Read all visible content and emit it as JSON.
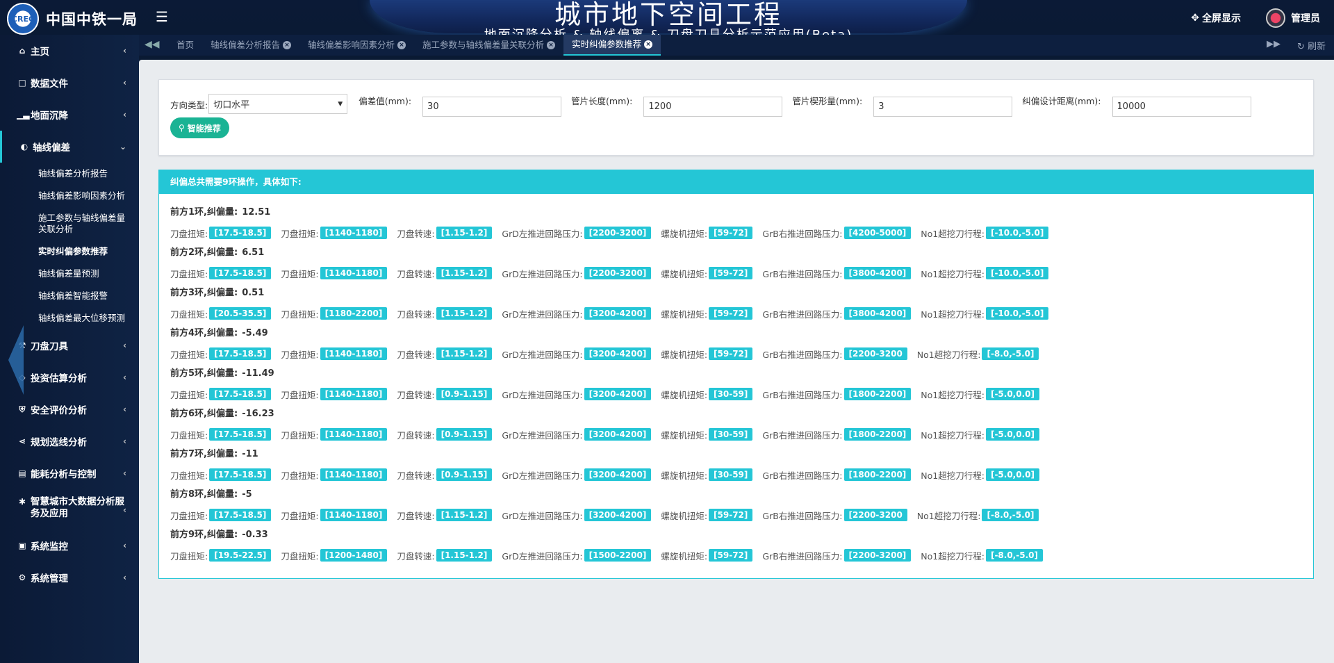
{
  "header": {
    "logo_badge": "CREC",
    "company": "中国中铁一局",
    "title": "城市地下空间工程",
    "subtitle": "地面沉降分析 & 轴线偏离 & 刀盘刀具分析示范应用(Beta)",
    "fullscreen": "全屏显示",
    "user": "管理员"
  },
  "tabs": {
    "items": [
      {
        "label": "首页",
        "closable": false
      },
      {
        "label": "轴线偏差分析报告",
        "closable": true
      },
      {
        "label": "轴线偏差影响因素分析",
        "closable": true
      },
      {
        "label": "施工参数与轴线偏差量关联分析",
        "closable": true
      },
      {
        "label": "实时纠偏参数推荐",
        "closable": true,
        "active": true
      }
    ],
    "refresh": "刷新"
  },
  "sidebar": {
    "items": [
      {
        "label": "主页",
        "icon": "home-icon"
      },
      {
        "label": "数据文件",
        "icon": "file-icon"
      },
      {
        "label": "地面沉降",
        "icon": "bar-chart-icon"
      },
      {
        "label": "轴线偏差",
        "icon": "globe-icon",
        "open": true
      },
      {
        "label": "刀盘刀具",
        "icon": "gavel-icon"
      },
      {
        "label": "投资估算分析",
        "icon": "diamond-icon"
      },
      {
        "label": "安全评价分析",
        "icon": "shield-icon"
      },
      {
        "label": "规划选线分析",
        "icon": "share-icon"
      },
      {
        "label": "能耗分析与控制",
        "icon": "bank-icon"
      },
      {
        "label": "智慧城市大数据分析服务及应用",
        "icon": "asterisk-icon"
      },
      {
        "label": "系统监控",
        "icon": "video-icon"
      },
      {
        "label": "系统管理",
        "icon": "gear-icon"
      }
    ],
    "sub_items": [
      "轴线偏差分析报告",
      "轴线偏差影响因素分析",
      "施工参数与轴线偏差量关联分析",
      "实时纠偏参数推荐",
      "轴线偏差量预测",
      "轴线偏差智能报警",
      "轴线偏差最大位移预测"
    ]
  },
  "form": {
    "direction_label": "方向类型:",
    "direction_value": "切口水平",
    "deviation_label": "偏差值(mm):",
    "deviation_value": "30",
    "segment_length_label": "管片长度(mm):",
    "segment_length_value": "1200",
    "wedge_label": "管片楔形量(mm):",
    "wedge_value": "3",
    "design_distance_label": "纠偏设计距离(mm):",
    "design_distance_value": "10000",
    "recommend_button": "智能推荐"
  },
  "result": {
    "heading": "纠偏总共需要9环操作，具体如下:",
    "param_labels": [
      "刀盘扭矩:",
      "刀盘扭矩:",
      "刀盘转速:",
      "GrD左推进回路压力:",
      "螺旋机扭矩:",
      "GrB右推进回路压力:",
      "No1超挖刀行程:"
    ],
    "rings": [
      {
        "title": "前方1环,纠偏量:",
        "value": "12.51",
        "params": [
          "[17.5-18.5]",
          "[1140-1180]",
          "[1.15-1.2]",
          "[2200-3200]",
          "[59-72]",
          "[4200-5000]",
          "[-10.0,-5.0]"
        ]
      },
      {
        "title": "前方2环,纠偏量:",
        "value": "6.51",
        "params": [
          "[17.5-18.5]",
          "[1140-1180]",
          "[1.15-1.2]",
          "[2200-3200]",
          "[59-72]",
          "[3800-4200]",
          "[-10.0,-5.0]"
        ]
      },
      {
        "title": "前方3环,纠偏量:",
        "value": "0.51",
        "params": [
          "[20.5-35.5]",
          "[1180-2200]",
          "[1.15-1.2]",
          "[3200-4200]",
          "[59-72]",
          "[3800-4200]",
          "[-10.0,-5.0]"
        ]
      },
      {
        "title": "前方4环,纠偏量:",
        "value": "-5.49",
        "params": [
          "[17.5-18.5]",
          "[1140-1180]",
          "[1.15-1.2]",
          "[3200-4200]",
          "[59-72]",
          "[2200-3200",
          "[-8.0,-5.0]"
        ]
      },
      {
        "title": "前方5环,纠偏量:",
        "value": "-11.49",
        "params": [
          "[17.5-18.5]",
          "[1140-1180]",
          "[0.9-1.15]",
          "[3200-4200]",
          "[30-59]",
          "[1800-2200]",
          "[-5.0,0.0]"
        ]
      },
      {
        "title": "前方6环,纠偏量:",
        "value": "-16.23",
        "params": [
          "[17.5-18.5]",
          "[1140-1180]",
          "[0.9-1.15]",
          "[3200-4200]",
          "[30-59]",
          "[1800-2200]",
          "[-5.0,0.0]"
        ]
      },
      {
        "title": "前方7环,纠偏量:",
        "value": "-11",
        "params": [
          "[17.5-18.5]",
          "[1140-1180]",
          "[0.9-1.15]",
          "[3200-4200]",
          "[30-59]",
          "[1800-2200]",
          "[-5.0,0.0]"
        ]
      },
      {
        "title": "前方8环,纠偏量:",
        "value": "-5",
        "params": [
          "[17.5-18.5]",
          "[1140-1180]",
          "[1.15-1.2]",
          "[3200-4200]",
          "[59-72]",
          "[2200-3200",
          "[-8.0,-5.0]"
        ]
      },
      {
        "title": "前方9环,纠偏量:",
        "value": "-0.33",
        "params": [
          "[19.5-22.5]",
          "[1200-1480]",
          "[1.15-1.2]",
          "[1500-2200]",
          "[59-72]",
          "[2200-3200]",
          "[-8.0,-5.0]"
        ]
      }
    ]
  },
  "colors": {
    "accent": "#24c6d6",
    "button": "#1ab394",
    "sidebar": "#0b1a36"
  }
}
